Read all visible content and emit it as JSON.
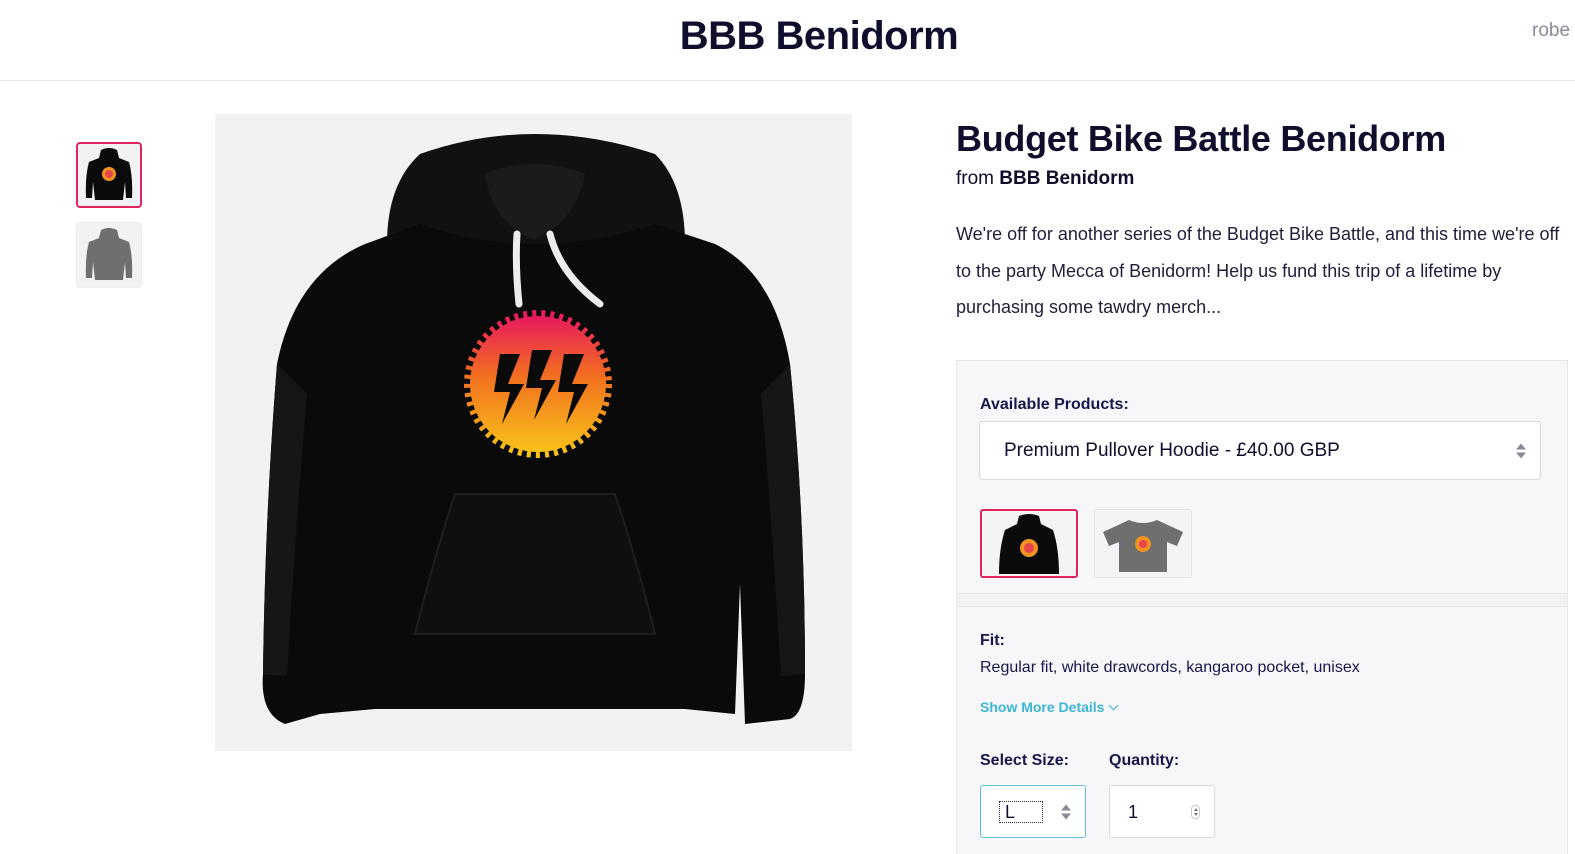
{
  "header": {
    "store_name": "BBB Benidorm",
    "user_link_text": "robe"
  },
  "gallery": {
    "thumbnails": [
      {
        "name": "black-hoodie-thumbnail",
        "selected": true
      },
      {
        "name": "grey-hoodie-back-thumbnail",
        "selected": false
      }
    ],
    "main_image": "black-hoodie-with-orange-logo"
  },
  "product": {
    "title": "Budget Bike Battle Benidorm",
    "by_prefix": "from",
    "by_store": "BBB Benidorm",
    "description": "We're off for another series of the Budget Bike Battle, and this time we're off to the party Mecca of Benidorm! Help us fund this trip of a lifetime by purchasing some tawdry merch..."
  },
  "options": {
    "available_label": "Available Products:",
    "selected_product": "Premium Pullover Hoodie - £40.00 GBP",
    "product_tiles": [
      {
        "name": "hoodie-tile",
        "selected": true
      },
      {
        "name": "tshirt-tile",
        "selected": false
      }
    ],
    "fit_label": "Fit:",
    "fit_text": "Regular fit, white drawcords, kangaroo pocket, unisex",
    "more_details": "Show More Details",
    "size_label": "Select Size:",
    "size_value": "L",
    "quantity_label": "Quantity:",
    "quantity_value": "1"
  },
  "colors": {
    "accent_selected": "#e0245e",
    "link": "#3cb6d3",
    "text_dark": "#0f0f2d"
  }
}
